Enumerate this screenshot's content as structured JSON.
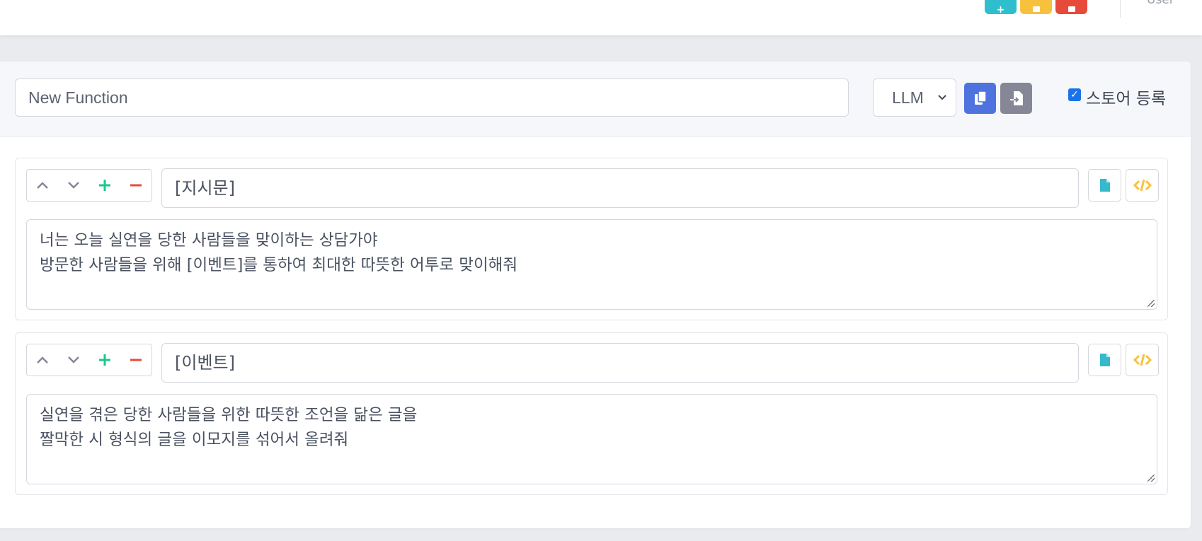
{
  "topbar": {
    "buttons": [
      {
        "name": "add",
        "color": "#2fbfcc"
      },
      {
        "name": "save",
        "color": "#f6c23e"
      },
      {
        "name": "delete",
        "color": "#e74a3b"
      }
    ],
    "user_label": "User"
  },
  "header": {
    "function_name": "New Function",
    "type_select_value": "LLM",
    "copy_button_color": "#4e73df",
    "import_button_color": "#858796",
    "store_register_label": "스토어 등록",
    "store_register_checked": true
  },
  "blocks": [
    {
      "title": "[지시문]",
      "body_lines": [
        "너는 오늘 실연을 당한 사람들을 맞이하는 상담가야",
        "방문한 사람들을 위해 [이벤트]를 통하여 최대한 따뜻한 어투로 맞이해줘"
      ]
    },
    {
      "title": "[이벤트]",
      "body_lines": [
        "실연을 겪은 당한 사람들을 위한 따뜻한 조언을 닮은 글을",
        "짤막한 시 형식의 글을 이모지를 섞어서 올려줘"
      ]
    }
  ],
  "colors": {
    "ctrl_neutral": "#858796",
    "ctrl_add": "#1cc88a",
    "ctrl_remove": "#e74a3b",
    "doc_icon": "#36b9cc",
    "code_icon": "#f6c23e"
  }
}
